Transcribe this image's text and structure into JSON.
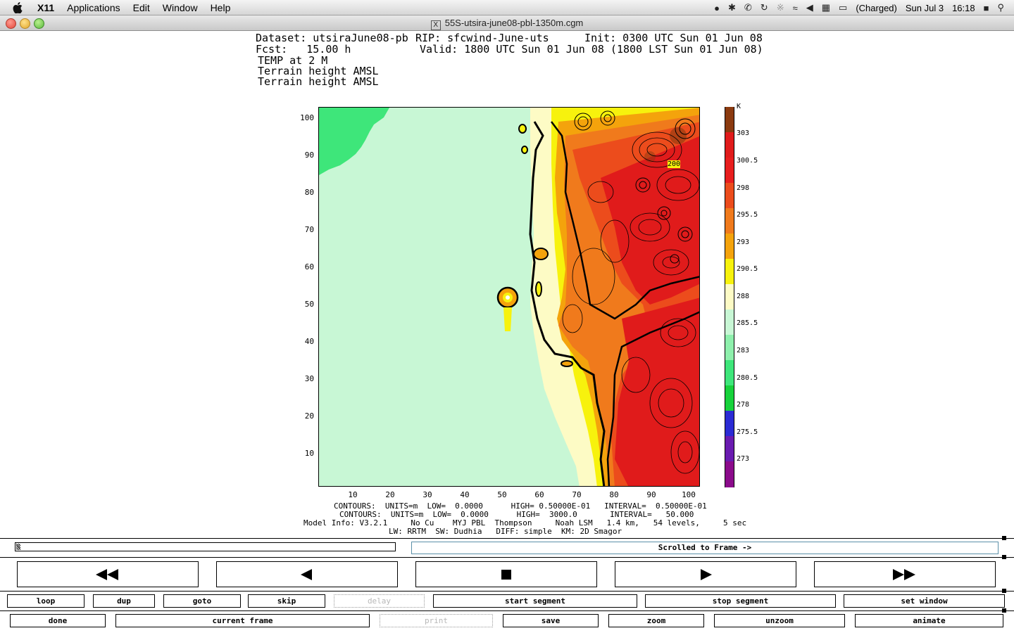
{
  "menubar": {
    "app": "X11",
    "items": [
      "Applications",
      "Edit",
      "Window",
      "Help"
    ],
    "battery": "(Charged)",
    "date": "Sun Jul 3",
    "time": "16:18"
  },
  "window": {
    "title": "55S-utsira-june08-pbl-1350m.cgm"
  },
  "header": {
    "dataset": "Dataset: utsiraJune08-pb",
    "rip": "RIP: sfcwind-June-uts",
    "init": "Init: 0300 UTC Sun 01 Jun 08",
    "fcst": "Fcst:   15.00 h",
    "valid": "Valid: 1800 UTC Sun 01 Jun 08 (1800 LST Sun 01 Jun 08)",
    "field1": "TEMP at 2 M",
    "field2": "Terrain height AMSL",
    "field3": "Terrain height AMSL"
  },
  "chart_data": {
    "type": "heatmap",
    "y_ticks": [
      "100",
      "90",
      "80",
      "70",
      "60",
      "50",
      "40",
      "30",
      "20",
      "10"
    ],
    "x_ticks": [
      "10",
      "20",
      "30",
      "40",
      "50",
      "60",
      "70",
      "80",
      "90",
      "100"
    ],
    "xlim": [
      1,
      102
    ],
    "ylim": [
      1,
      102
    ],
    "contour_label": "200",
    "colorbar": {
      "unit": "K",
      "labels": [
        "303",
        "300.5",
        "298",
        "295.5",
        "293",
        "290.5",
        "288",
        "285.5",
        "283",
        "280.5",
        "278",
        "275.5",
        "273"
      ],
      "colors": [
        "#8b3a0f",
        "#e01b1b",
        "#e81e1e",
        "#ec4c1c",
        "#f07a1c",
        "#f4a30c",
        "#f7f20d",
        "#fdfbc5",
        "#c8f7d5",
        "#8ef0ac",
        "#3ee67a",
        "#17d23b",
        "#2b2bd4",
        "#6a1bb0",
        "#8b0b8b"
      ]
    }
  },
  "footer": {
    "line1": "CONTOURS:  UNITS=m  LOW=  0.0000      HIGH= 0.50000E-01   INTERVAL=  0.50000E-01",
    "line2": "CONTOURS:  UNITS=m  LOW=  0.0000      HIGH=  3000.0       INTERVAL=   50.000",
    "line3": "Model Info: V3.2.1     No Cu    MYJ PBL  Thompson     Noah LSM   1.4 km,   54 levels,     5 sec",
    "line4": "LW: RRTM  SW: Dudhia   DIFF: simple  KM: 2D Smagor"
  },
  "controls": {
    "status": "Scrolled to Frame ->",
    "row1": [
      "loop",
      "dup",
      "goto",
      "skip",
      "delay",
      "start segment",
      "stop segment",
      "set window"
    ],
    "row2": [
      "done",
      "current frame",
      "print",
      "save",
      "zoom",
      "unzoom",
      "animate"
    ]
  }
}
